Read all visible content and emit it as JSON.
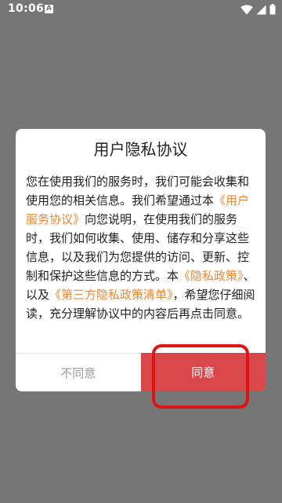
{
  "status_bar": {
    "time": "10:06",
    "notification_icon_letter": "A",
    "icons": [
      "wifi-icon",
      "signal-icon",
      "battery-icon"
    ]
  },
  "dialog": {
    "title": "用户隐私协议",
    "body": {
      "p1": "您在使用我们的服务时，我们可能会收集和使用您的相关信息。我们希望通过本",
      "link_user_agreement": "《用户服务协议》",
      "p2": "向您说明，在使用我们的服务时，我们如何收集、使用、储存和分享这些信息，以及我们为您提供的访问、更新、控制和保护这些信息的方式。本",
      "link_privacy_policy": "《隐私政策》",
      "p3": "、以及",
      "link_third_party": "《第三方隐私政策清单》",
      "p4": "，希望您仔细阅读，充分理解协议中的内容后再点击同意。"
    },
    "cancel_label": "不同意",
    "agree_label": "同意"
  },
  "colors": {
    "overlay_background": "#767676",
    "link": "#f0883a",
    "agree_button": "#d9474b",
    "highlight_box": "#e01414"
  }
}
